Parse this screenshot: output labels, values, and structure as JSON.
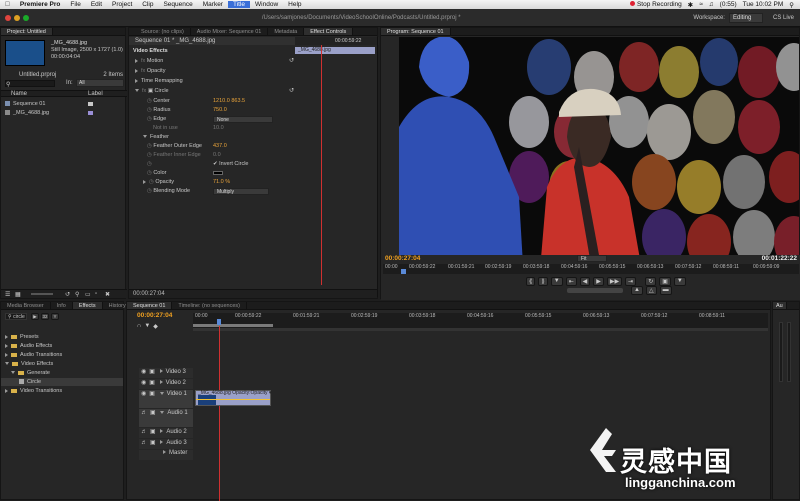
{
  "menubar": {
    "app": "Premiere Pro",
    "items": [
      "File",
      "Edit",
      "Project",
      "Clip",
      "Sequence",
      "Marker",
      "Title",
      "Window",
      "Help"
    ],
    "recording": "Stop Recording",
    "battery": "(0:55)",
    "datetime": "Tue 10:02 PM"
  },
  "titlebar": {
    "path": "/Users/samjones/Documents/VideoSchoolOnline/Podcasts/Untitled.prproj *",
    "workspace_label": "Workspace:",
    "workspace_value": "Editing",
    "cs_live": "CS Live"
  },
  "project": {
    "tab": "Project: Untitled",
    "clip_name": "_MG_4688.jpg",
    "clip_info": "Still Image, 2500 x 1727 (1.0)",
    "clip_dur": "00:00:04:04",
    "project_file": "Untitled.prproj",
    "item_count": "2 Items",
    "in_label": "In:",
    "in_value": "All",
    "col_name": "Name",
    "col_label": "Label",
    "items": [
      "Sequence 01",
      "_MG_4688.jpg"
    ]
  },
  "source_tabs": [
    "Source: (no clips)",
    "Audio Mixer: Sequence 01",
    "Metadata",
    "Effect Controls"
  ],
  "effect_controls": {
    "header": "Sequence 01 * _MG_4688.jpg",
    "timecode_top": "00:00:59:22",
    "clip_bar": "_MG_4688.jpg",
    "video_effects": "Video Effects",
    "motion": "Motion",
    "opacity": "Opacity",
    "time_remap": "Time Remapping",
    "circle": "Circle",
    "params": [
      {
        "name": "Center",
        "value": "1210.0    863.5"
      },
      {
        "name": "Radius",
        "value": "750.0"
      },
      {
        "name": "Edge",
        "value": "None"
      },
      {
        "name": "Not in use",
        "value": "10.0"
      },
      {
        "name": "Feather",
        "value": ""
      },
      {
        "name": "Feather Outer Edge",
        "value": "437.0"
      },
      {
        "name": "Feather Inner Edge",
        "value": "0.0"
      },
      {
        "name": "",
        "value": "Invert Circle"
      },
      {
        "name": "Color",
        "value": ""
      },
      {
        "name": "Opacity",
        "value": "71.0 %"
      },
      {
        "name": "Blending Mode",
        "value": "Multiply"
      }
    ],
    "timecode_bottom": "00:00:27:04"
  },
  "program": {
    "tab": "Program: Sequence 01",
    "timecode_current": "00:00:27:04",
    "fit": "Fit",
    "timecode_duration": "00:01:22:22",
    "ruler": [
      "00:00",
      "00:00:59:22",
      "00:01:59:21",
      "00:02:59:19",
      "00:03:59:18",
      "00:04:59:16",
      "00:05:59:15",
      "00:06:59:13",
      "00:07:59:12",
      "00:08:59:11",
      "00:09:59:09"
    ]
  },
  "effects_panel": {
    "tabs": [
      "Media Browser",
      "Info",
      "Effects",
      "History"
    ],
    "search": "circle",
    "tree": [
      {
        "label": "Presets",
        "level": 0,
        "open": false
      },
      {
        "label": "Audio Effects",
        "level": 0,
        "open": false
      },
      {
        "label": "Audio Transitions",
        "level": 0,
        "open": false
      },
      {
        "label": "Video Effects",
        "level": 0,
        "open": true
      },
      {
        "label": "Generate",
        "level": 1,
        "open": true
      },
      {
        "label": "Circle",
        "level": 2,
        "open": false
      },
      {
        "label": "Video Transitions",
        "level": 0,
        "open": false
      }
    ]
  },
  "timeline": {
    "tabs": [
      "Sequence 01",
      "Timeline: (no sequences)"
    ],
    "timecode": "00:00:27:04",
    "ruler": [
      "00:00",
      "00:00:59:22",
      "00:01:59:21",
      "00:02:59:19",
      "00:03:59:18",
      "00:04:59:16",
      "00:05:59:15",
      "00:06:59:13",
      "00:07:59:12",
      "00:08:59:11"
    ],
    "tracks_video": [
      "Video 3",
      "Video 2",
      "Video 1"
    ],
    "tracks_audio": [
      "Audio 1",
      "Audio 2",
      "Audio 3",
      "Master"
    ],
    "clip_label": "_MG_4688.jpg Opacity:Opacity ▾"
  },
  "audio_meter": {
    "label": "Au"
  },
  "watermark": {
    "cn": "灵感中国",
    "url": "lingganchina.com"
  },
  "colors": {
    "accent_timecode": "#f0a020",
    "playhead": "#d03030",
    "clip_video": "#9aa0c8"
  }
}
